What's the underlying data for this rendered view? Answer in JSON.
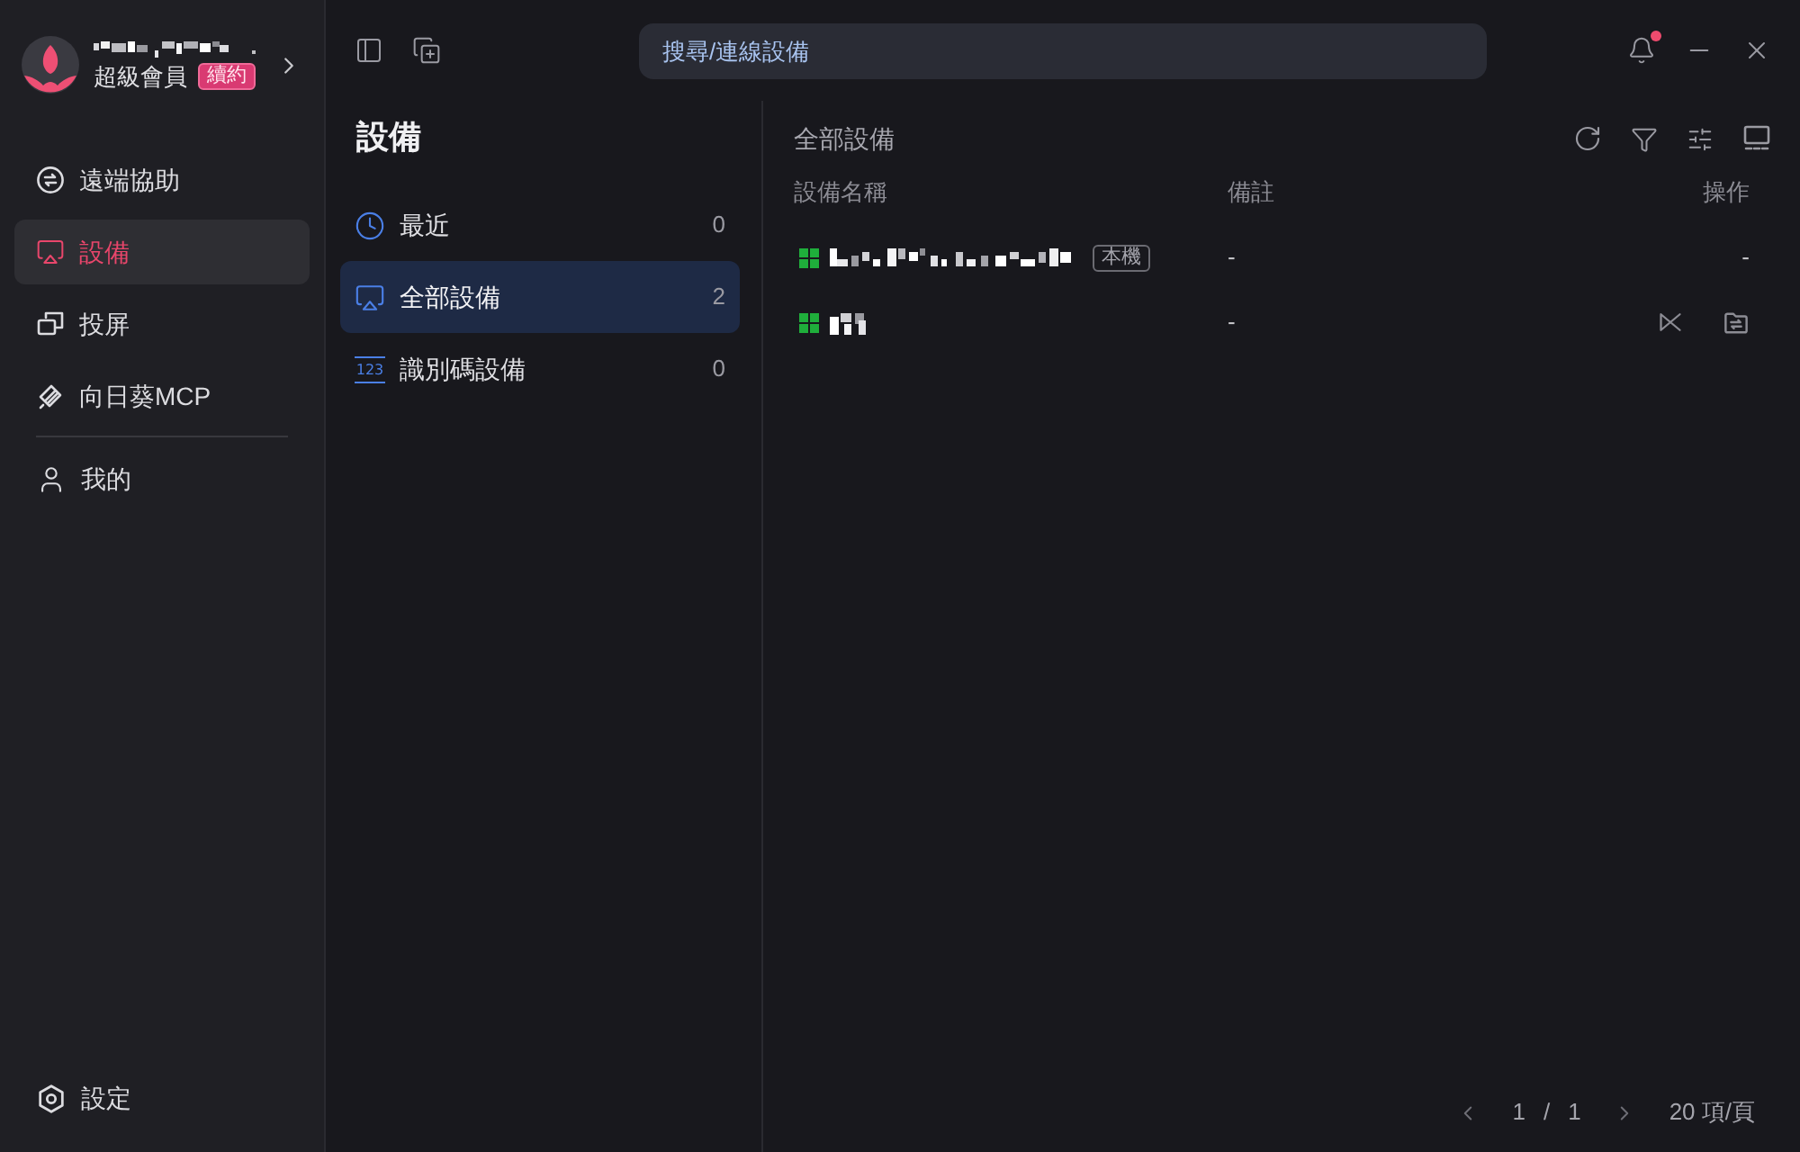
{
  "account": {
    "membership": "超級會員",
    "badge": "續約"
  },
  "nav": [
    {
      "kind": "remote",
      "label": "遠端協助",
      "selected": false
    },
    {
      "kind": "devices",
      "label": "設備",
      "selected": true
    },
    {
      "kind": "cast",
      "label": "投屏",
      "selected": false
    },
    {
      "kind": "mcp",
      "label": "向日葵MCP",
      "selected": false
    }
  ],
  "nav_secondary": [
    {
      "kind": "profile",
      "label": "我的",
      "selected": false
    }
  ],
  "settings": {
    "label": "設定"
  },
  "search": {
    "placeholder": "搜尋/連線設備"
  },
  "notifications": {
    "unread": true
  },
  "device_groups": {
    "title": "設備",
    "items": [
      {
        "kind": "recent",
        "label": "最近",
        "count": "0",
        "selected": false
      },
      {
        "kind": "all",
        "label": "全部設備",
        "count": "2",
        "selected": true
      },
      {
        "kind": "code",
        "icon_text": "123",
        "label": "識別碼設備",
        "count": "0",
        "selected": false
      }
    ]
  },
  "device_list": {
    "title": "全部設備",
    "columns": [
      "設備名稱",
      "備註",
      "操作"
    ],
    "rows": [
      {
        "kind": "local",
        "tag": "本機",
        "note": "-",
        "action": "-"
      },
      {
        "kind": "remote",
        "note": "-"
      }
    ]
  },
  "pagination": {
    "current": "1",
    "separator": "/",
    "total": "1",
    "page_size": "20 項/頁"
  }
}
